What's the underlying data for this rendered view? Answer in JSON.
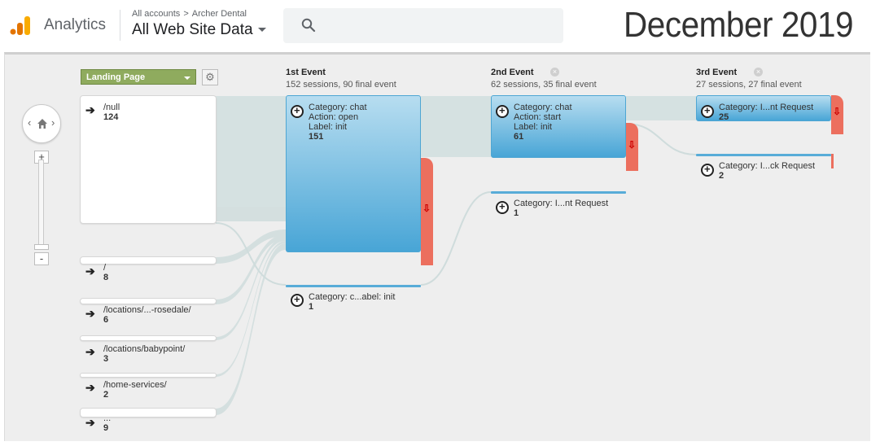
{
  "header": {
    "app_name": "Analytics",
    "breadcrumb_all": "All accounts",
    "breadcrumb_sep": ">",
    "breadcrumb_account": "Archer Dental",
    "property": "All Web Site Data",
    "overlay_title": "December 2019"
  },
  "controls": {
    "zoom_in": "+",
    "zoom_out": "-",
    "dimension_label": "Landing Page"
  },
  "columns": [
    {
      "title": "1st Event",
      "summary": "152 sessions, 90 final event"
    },
    {
      "title": "2nd Event",
      "summary": "62 sessions, 35 final event"
    },
    {
      "title": "3rd Event",
      "summary": "27 sessions, 27 final event"
    }
  ],
  "landing_pages": [
    {
      "page": "/null",
      "count": "124"
    },
    {
      "page": "/",
      "count": "8"
    },
    {
      "page": "/locations/...-rosedale/",
      "count": "6"
    },
    {
      "page": "/locations/babypoint/",
      "count": "3"
    },
    {
      "page": "/home-services/",
      "count": "2"
    },
    {
      "page": "...",
      "count": "9"
    }
  ],
  "event1": [
    {
      "l1": "Category: chat",
      "l2": "Action: open",
      "l3": "Label: init",
      "count": "151"
    },
    {
      "l1": "Category: c...abel: init",
      "count": "1"
    }
  ],
  "event2": [
    {
      "l1": "Category: chat",
      "l2": "Action: start",
      "l3": "Label: init",
      "count": "61"
    },
    {
      "l1": "Category: I...nt Request",
      "count": "1"
    }
  ],
  "event3": [
    {
      "l1": "Category: I...nt Request",
      "count": "25"
    },
    {
      "l1": "Category: I...ck Request",
      "count": "2"
    }
  ],
  "colors": {
    "flow": "#d2dede",
    "event_bar": "#4ea6d3",
    "drop_off": "#ec6f5e",
    "landing_dropdown": "#8fab5e"
  }
}
